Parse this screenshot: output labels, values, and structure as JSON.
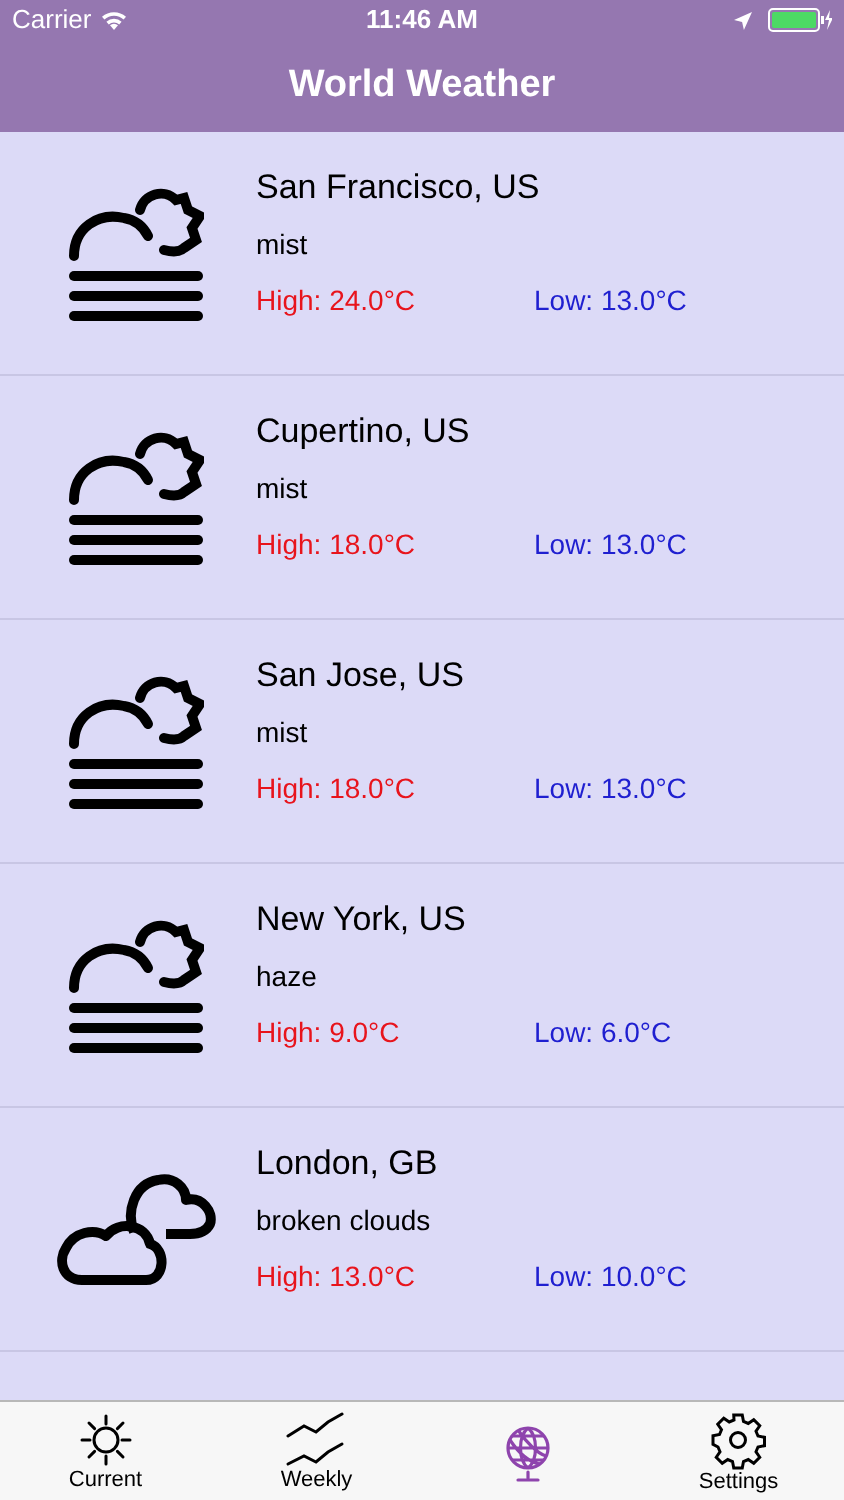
{
  "status_bar": {
    "carrier": "Carrier",
    "time": "11:46 AM"
  },
  "nav_bar": {
    "title": "World Weather"
  },
  "cities": [
    {
      "name": "San Francisco, US",
      "description": "mist",
      "high": "High: 24.0°C",
      "low": "Low: 13.0°C",
      "kind": "fog"
    },
    {
      "name": "Cupertino, US",
      "description": "mist",
      "high": "High: 18.0°C",
      "low": "Low: 13.0°C",
      "kind": "fog"
    },
    {
      "name": "San Jose, US",
      "description": "mist",
      "high": "High: 18.0°C",
      "low": "Low: 13.0°C",
      "kind": "fog"
    },
    {
      "name": "New York, US",
      "description": "haze",
      "high": "High: 9.0°C",
      "low": "Low: 6.0°C",
      "kind": "fog"
    },
    {
      "name": "London, GB",
      "description": "broken clouds",
      "high": "High: 13.0°C",
      "low": "Low: 10.0°C",
      "kind": "clouds"
    }
  ],
  "tab_bar": [
    {
      "kind": "sun",
      "label": "Current",
      "selected": false
    },
    {
      "kind": "chart",
      "label": "Weekly",
      "selected": false
    },
    {
      "kind": "globe",
      "selected": true
    },
    {
      "kind": "gear",
      "label": "Settings",
      "selected": false
    }
  ]
}
